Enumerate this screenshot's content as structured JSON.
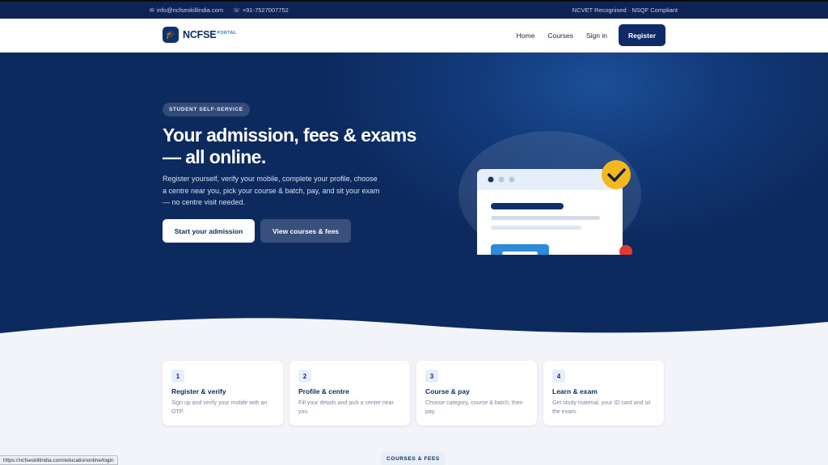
{
  "topbar": {
    "email": "info@ncfseskillindia.com",
    "phone": "+91-7527007752",
    "compliance": "NCVET Recognised · NSQF Compliant"
  },
  "nav": {
    "logo_text": "NCFSE",
    "logo_sup": "PORTAL",
    "links": [
      "Home",
      "Courses",
      "Sign in"
    ],
    "register_label": "Register"
  },
  "hero": {
    "badge": "STUDENT SELF-SERVICE",
    "headline": "Your admission, fees & exams — all online.",
    "subtext": "Register yourself, verify your mobile, complete your profile, choose a centre near you, pick your course & batch, pay, and sit your exam — no centre visit needed.",
    "primary_button": "Start your admission",
    "secondary_button": "View courses & fees"
  },
  "steps": [
    {
      "num": "1",
      "title": "Register & verify",
      "desc": "Sign up and verify your mobile with an OTP."
    },
    {
      "num": "2",
      "title": "Profile & centre",
      "desc": "Fill your details and pick a centre near you."
    },
    {
      "num": "3",
      "title": "Course & pay",
      "desc": "Choose category, course & batch, then pay."
    },
    {
      "num": "4",
      "title": "Learn & exam",
      "desc": "Get study material, your ID card and sit the exam."
    }
  ],
  "section_label": "COURSES & FEES",
  "status_url": "https://ncfseskillindia.com/educationonline/login",
  "colors": {
    "navy": "#0e2456",
    "accent_blue": "#2f8ad8",
    "check_yellow": "#f4b81f",
    "dot_red": "#e03a31"
  }
}
